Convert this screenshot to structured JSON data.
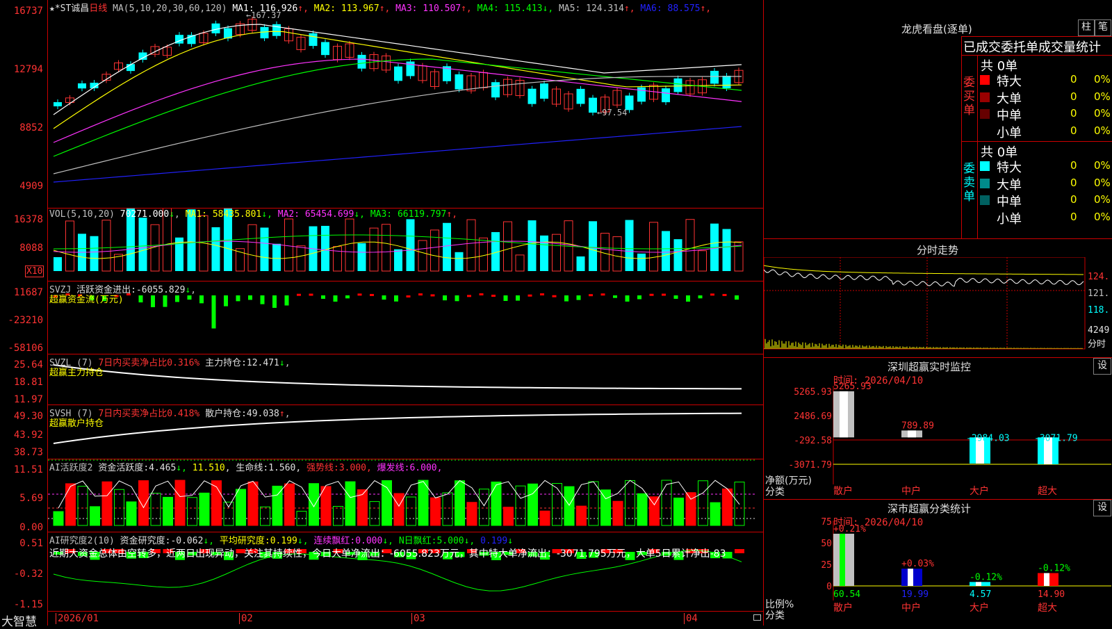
{
  "main": {
    "stock": "★*ST诚昌",
    "period": "日线",
    "ma_params": "MA(5,10,20,30,60,120)",
    "ma": [
      {
        "label": "MA1:",
        "value": "116.926",
        "arrow": "↑",
        "color": "#ffffff"
      },
      {
        "label": "MA2:",
        "value": "113.967",
        "arrow": "↑",
        "color": "#ffff00"
      },
      {
        "label": "MA3:",
        "value": "110.507",
        "arrow": "↑",
        "color": "#ff33ff"
      },
      {
        "label": "MA4:",
        "value": "115.413",
        "arrow": "↓",
        "color": "#00ff00"
      },
      {
        "label": "MA5:",
        "value": "124.314",
        "arrow": "↑",
        "color": "#c0c0c0"
      },
      {
        "label": "MA6:",
        "value": "88.575",
        "arrow": "↑",
        "color": "#2222ff"
      }
    ],
    "y_ticks": [
      "16737",
      "12794",
      "8852",
      "4909"
    ],
    "high_label": "167.37",
    "low_label": "97.54",
    "high_arrow": "←",
    "low_arrow": "←"
  },
  "vol": {
    "title": "VOL(5,10,20)",
    "value": "70271.000",
    "value_arrow": "↓",
    "ma": [
      {
        "label": "MA1:",
        "value": "58435.801",
        "arrow": "↓",
        "color": "#ffff00"
      },
      {
        "label": "MA2:",
        "value": "65454.699",
        "arrow": "↓",
        "color": "#ff33ff"
      },
      {
        "label": "MA3:",
        "value": "66119.797",
        "arrow": "↑",
        "color": "#00ff00"
      }
    ],
    "y_ticks": [
      "16378",
      "8088"
    ],
    "unit": "X10"
  },
  "svzj": {
    "title": "SVZJ",
    "label": "活跃资金进出:",
    "value": "-6055.829",
    "arrow": "↓",
    "subtitle": "超赢资金流(万元)",
    "y_ticks": [
      "11687",
      "-23210",
      "-58106"
    ]
  },
  "svzl": {
    "title": "SVZL (7)",
    "text1": "7日内买卖净占比0.316%",
    "label": "主力持仓:",
    "value": "12.471",
    "arrow": "↓",
    "subtitle": "超赢主力持仓",
    "y_ticks": [
      "25.64",
      "18.81",
      "11.97"
    ]
  },
  "svsh": {
    "title": "SVSH (7)",
    "text1": "7日内买卖净占比0.418%",
    "label": "散户持仓:",
    "value": "49.038",
    "arrow": "↑",
    "subtitle": "超赢散户持仓",
    "y_ticks": [
      "49.30",
      "43.92",
      "38.73"
    ]
  },
  "ai1": {
    "title": "AI活跃度2",
    "label": "资金活跃度:",
    "value": "4.465",
    "v2": "11.510",
    "label3": "生命线:",
    "v3": "1.560",
    "label4": "强势线:",
    "v4": "3.000",
    "label5": "爆发线:",
    "v5": "6.000",
    "y_ticks": [
      "11.51",
      "5.69",
      "0.00"
    ]
  },
  "ai2": {
    "title": "AI研究度2(10)",
    "label": "资金研究度:",
    "value": "-0.062",
    "label2": "平均研究度:",
    "v2": "0.199",
    "label3": "连续飘红:",
    "v3": "0.000",
    "label4": "N日飘红:",
    "v4": "5.000",
    "v5": "0.199",
    "comment": "近期大资金总体由空转多，近两日出现异动，关注其持续性，今日大单净流出：-6055.823万元，其中特大单净流出：-3071.795万元，大单5日累计净出-83",
    "y_ticks": [
      "0.51",
      "-0.32",
      "-1.15"
    ]
  },
  "xaxis": {
    "labels": [
      "2026/01",
      "02",
      "03",
      "04"
    ],
    "logo": "大智慧"
  },
  "right": {
    "title": "龙虎看盘(逐单)",
    "btn1": "柱",
    "btn2": "笔",
    "header": "已成交委托单成交量统计",
    "buy": {
      "label": "委买单",
      "total": "共 0单",
      "rows": [
        {
          "name": "特大",
          "val": "0",
          "pct": "0%",
          "color": "#ff0000"
        },
        {
          "name": "大单",
          "val": "0",
          "pct": "0%",
          "color": "#990000"
        },
        {
          "name": "中单",
          "val": "0",
          "pct": "0%",
          "color": "#660000"
        },
        {
          "name": "小单",
          "val": "0",
          "pct": "0%",
          "color": ""
        }
      ]
    },
    "sell": {
      "label": "委卖单",
      "total": "共 0单",
      "rows": [
        {
          "name": "特大",
          "val": "0",
          "pct": "0%",
          "color": "#00ffff"
        },
        {
          "name": "大单",
          "val": "0",
          "pct": "0%",
          "color": "#008b8b"
        },
        {
          "name": "中单",
          "val": "0",
          "pct": "0%",
          "color": "#006060"
        },
        {
          "name": "小单",
          "val": "0",
          "pct": "0%",
          "color": ""
        }
      ]
    }
  },
  "fenshi": {
    "title": "分时走势",
    "y_ticks": [
      "124.",
      "121.",
      "118."
    ],
    "vol": "4249",
    "unit": "分时"
  },
  "sz": {
    "title": "深圳超赢实时监控",
    "btn": "设",
    "time": "时间: 2026/04/10",
    "y_ticks": [
      "5265.93",
      "2486.69",
      "-292.58",
      "-3071.79"
    ],
    "ylabel": "净额(万元)",
    "xlabel": "分类",
    "categories": [
      "散户",
      "中户",
      "大户",
      "超大"
    ],
    "values": [
      "5265.93",
      "789.89",
      "-2984.03",
      "-3071.79"
    ]
  },
  "ss": {
    "title": "深市超赢分类统计",
    "btn": "设",
    "time": "时间: 2026/04/10",
    "y_ticks": [
      "75",
      "50",
      "25",
      "0"
    ],
    "ylabel": "比例%",
    "xlabel": "分类",
    "categories": [
      "散户",
      "中户",
      "大户",
      "超大"
    ],
    "pct": [
      "+0.21%",
      "+0.03%",
      "-0.12%",
      "-0.12%"
    ],
    "values": [
      "60.54",
      "19.99",
      "4.57",
      "14.90"
    ]
  }
}
